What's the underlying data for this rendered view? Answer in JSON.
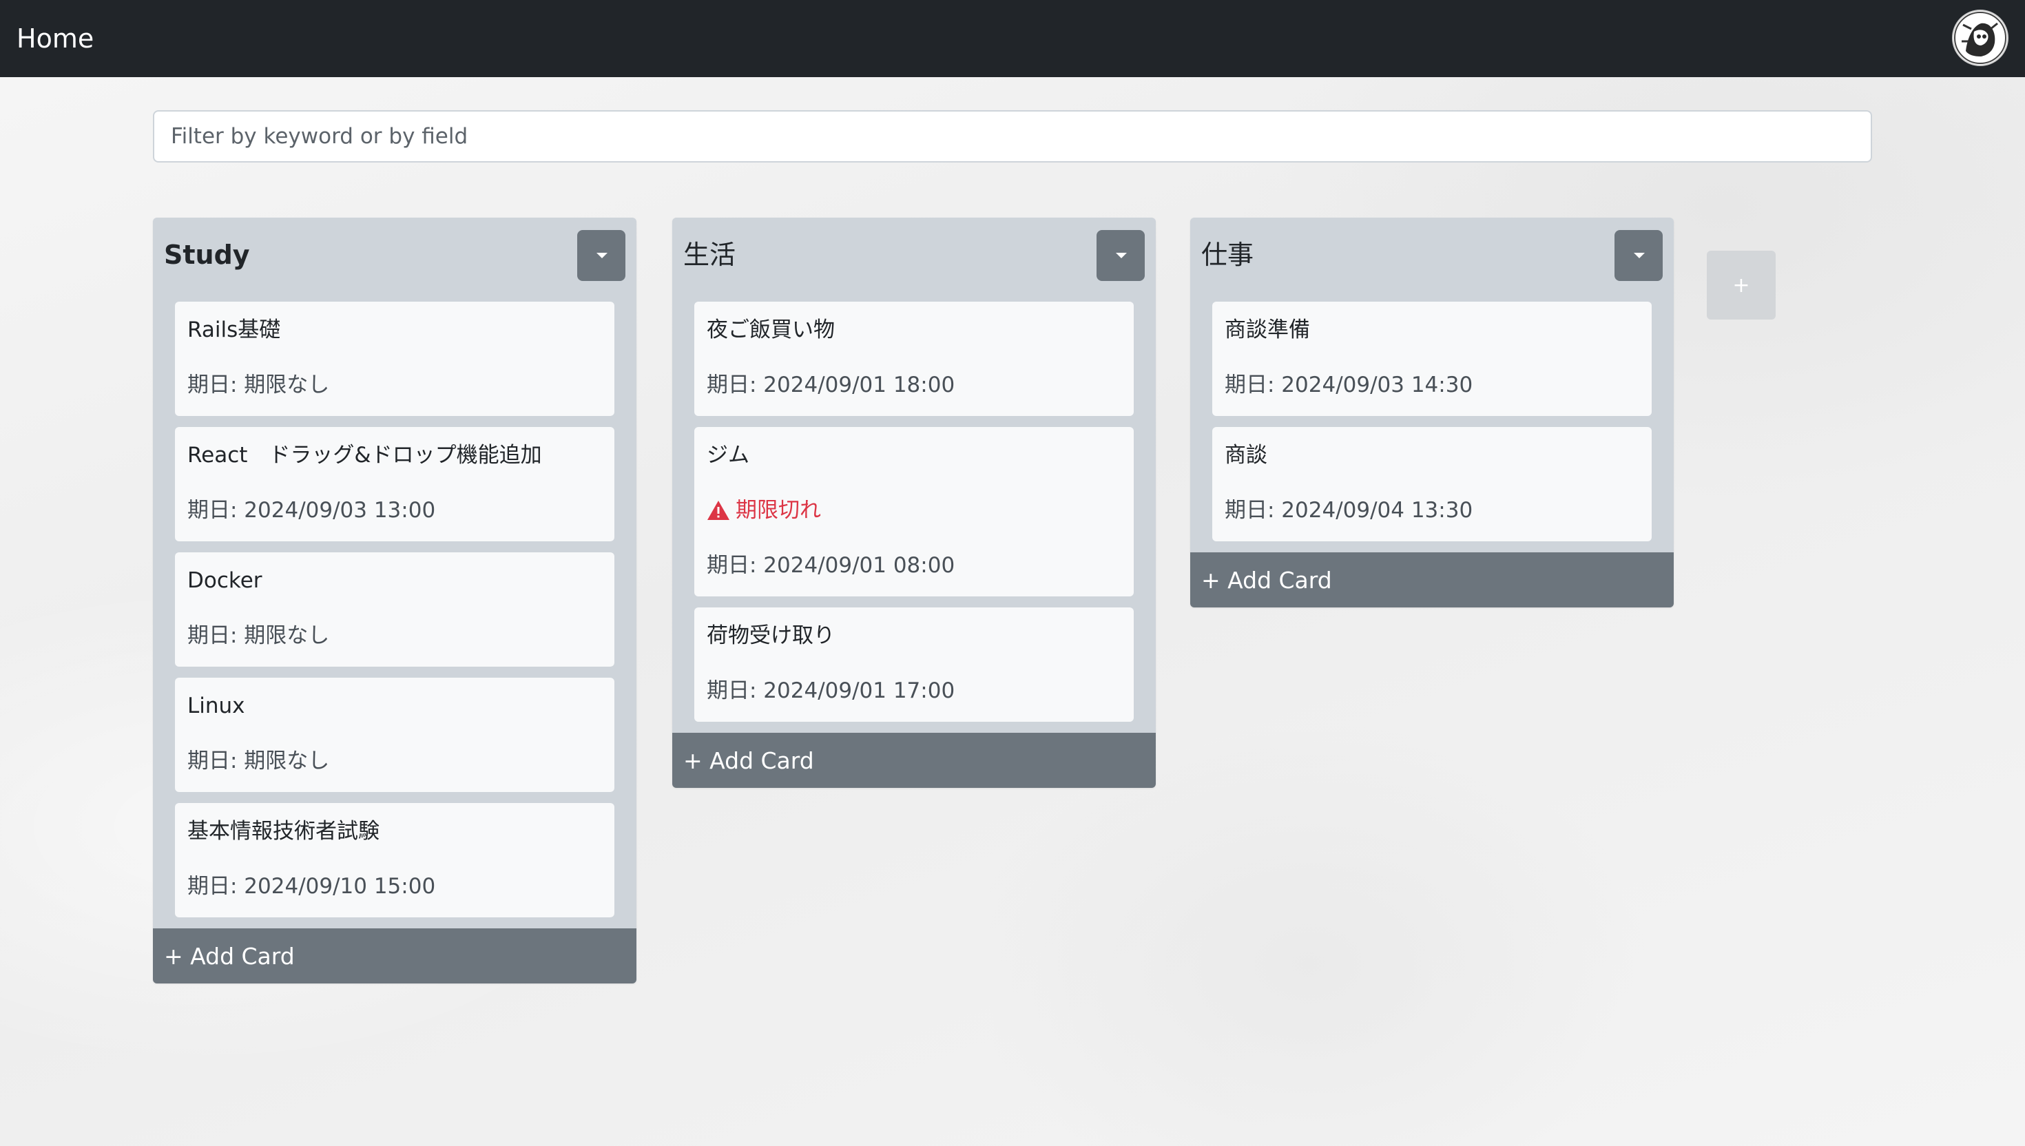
{
  "nav": {
    "brand": "Home",
    "avatar_icon": "user-avatar-icon"
  },
  "filter": {
    "placeholder": "Filter by keyword or by field",
    "value": ""
  },
  "columns": [
    {
      "title": "Study",
      "cards": [
        {
          "title": "Rails基礎",
          "due": "期日: 期限なし"
        },
        {
          "title": "React　ドラッグ&ドロップ機能追加",
          "due": "期日: 2024/09/03 13:00"
        },
        {
          "title": "Docker",
          "due": "期日: 期限なし"
        },
        {
          "title": "Linux",
          "due": "期日: 期限なし"
        },
        {
          "title": "基本情報技術者試験",
          "due": "期日: 2024/09/10 15:00"
        }
      ],
      "add_label": "+ Add Card"
    },
    {
      "title": "生活",
      "cards": [
        {
          "title": "夜ご飯買い物",
          "due": "期日: 2024/09/01 18:00"
        },
        {
          "title": "ジム",
          "warning": "期限切れ",
          "due": "期日: 2024/09/01 08:00"
        },
        {
          "title": "荷物受け取り",
          "due": "期日: 2024/09/01 17:00"
        }
      ],
      "add_label": "+ Add Card"
    },
    {
      "title": "仕事",
      "cards": [
        {
          "title": "商談準備",
          "due": "期日: 2024/09/03 14:30"
        },
        {
          "title": "商談",
          "due": "期日: 2024/09/04 13:30"
        }
      ],
      "add_label": "+ Add Card"
    }
  ],
  "add_column_label": "+",
  "colors": {
    "navbar": "#212529",
    "column_bg": "#ced4da",
    "card_bg": "#f8f9fa",
    "button_secondary": "#6c757d",
    "warning": "#dc3545"
  }
}
